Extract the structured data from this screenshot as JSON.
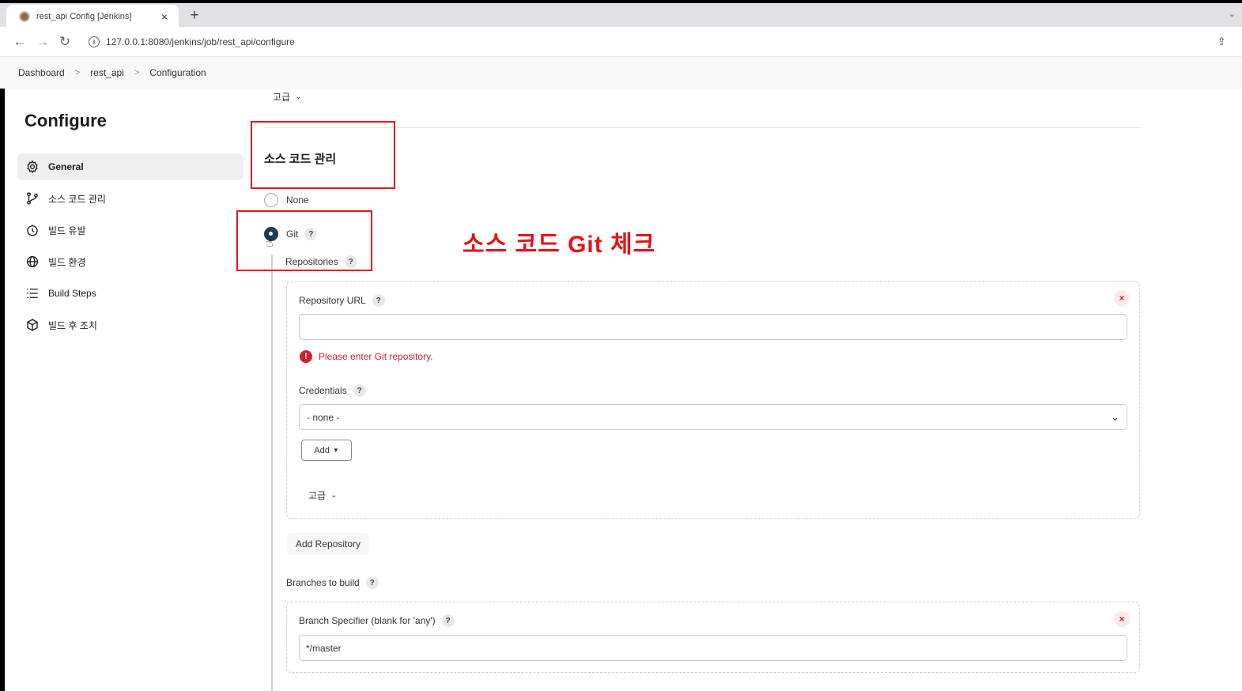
{
  "browser": {
    "tab_title": "rest_api Config [Jenkins]",
    "tab_close": "×",
    "new_tab": "+",
    "tab_menu": "⌄",
    "url": "127.0.0.1:8080/jenkins/job/rest_api/configure",
    "url_info": "i"
  },
  "breadcrumb": [
    "Dashboard",
    "rest_api",
    "Configuration"
  ],
  "page_title": "Configure",
  "sidebar": [
    {
      "label": "General",
      "icon": "gear-icon"
    },
    {
      "label": "소스 코드 관리",
      "icon": "branch-icon"
    },
    {
      "label": "빌드 유발",
      "icon": "timer-icon"
    },
    {
      "label": "빌드 환경",
      "icon": "globe-icon"
    },
    {
      "label": "Build Steps",
      "icon": "list-icon"
    },
    {
      "label": "빌드 후 조치",
      "icon": "package-icon"
    }
  ],
  "advanced_label": "고급",
  "scm": {
    "title": "소스 코드 관리",
    "option_none": "None",
    "option_git": "Git",
    "selected": "Git",
    "repositories_label": "Repositories",
    "repo_url_label": "Repository URL",
    "repo_url_value": "",
    "repo_url_error": "Please enter Git repository.",
    "credentials_label": "Credentials",
    "credentials_value": "- none -",
    "add_button": "Add",
    "advanced_label": "고급",
    "add_repository_button": "Add Repository",
    "branches_label": "Branches to build",
    "branch_specifier_label": "Branch Specifier (blank for 'any')",
    "branch_specifier_value": "*/master"
  },
  "help_glyph": "?",
  "remove_glyph": "×",
  "error_glyph": "!",
  "annotation": "소스 코드 Git 체크",
  "colors": {
    "annotation_red": "#e4131b",
    "error_red": "#d0212e",
    "radio_checked": "#1c3b55"
  }
}
